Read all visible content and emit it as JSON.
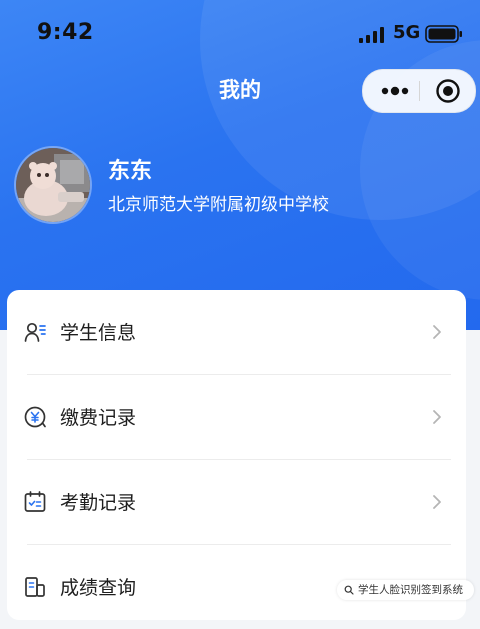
{
  "status_bar": {
    "time": "9:42",
    "network": "5G",
    "icons": [
      "signal-icon",
      "battery-icon"
    ]
  },
  "nav": {
    "title": "我的",
    "capsule_icons": [
      "more-dots-icon",
      "close-target-icon"
    ]
  },
  "profile": {
    "name": "东东",
    "school": "北京师范大学附属初级中学校",
    "avatar_icon": "avatar"
  },
  "menu": {
    "items": [
      {
        "label": "学生信息",
        "icon": "student-info-icon"
      },
      {
        "label": "缴费记录",
        "icon": "payment-record-icon"
      },
      {
        "label": "考勤记录",
        "icon": "attendance-record-icon"
      },
      {
        "label": "成绩查询",
        "icon": "score-query-icon"
      }
    ]
  },
  "watermark": {
    "text": "学生人脸识别签到系统",
    "icon": "search-icon"
  },
  "colors": {
    "header_blue": "#2a73f0",
    "icon_dark": "#333333",
    "chevron": "#b5b5b5",
    "page_bg": "#f3f5f8"
  }
}
